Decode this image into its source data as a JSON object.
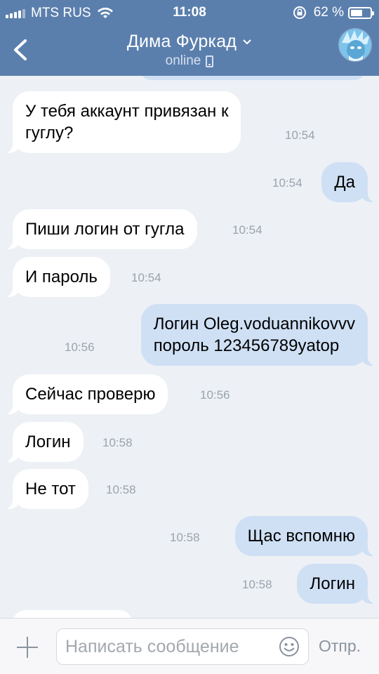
{
  "status_bar": {
    "carrier": "MTS RUS",
    "time": "11:08",
    "battery_percent": "62 %",
    "battery_level": 0.62,
    "icons": [
      "signal-icon",
      "wifi-icon",
      "rotation-lock-icon",
      "battery-icon"
    ]
  },
  "header": {
    "contact_name": "Дима Фуркад",
    "status": "online",
    "icons": [
      "back-arrow-icon",
      "chevron-down-icon",
      "mobile-phone-icon",
      "avatar"
    ],
    "background": "#5b7fad"
  },
  "messages": [
    {
      "dir": "in",
      "lines": [
        "У тебя аккаунт привязан к",
        "гуглу?"
      ],
      "time": "10:54"
    },
    {
      "dir": "out",
      "lines": [
        "Да"
      ],
      "time": "10:54"
    },
    {
      "dir": "in",
      "lines": [
        "Пиши логин от гугла"
      ],
      "time": "10:54"
    },
    {
      "dir": "in",
      "lines": [
        "И пароль"
      ],
      "time": "10:54"
    },
    {
      "dir": "out",
      "lines": [
        "Логин Oleg.voduannikovvv",
        "пороль 123456789yatop"
      ],
      "time": "10:56"
    },
    {
      "dir": "in",
      "lines": [
        "Сейчас проверю"
      ],
      "time": "10:56"
    },
    {
      "dir": "in",
      "lines": [
        "Логин"
      ],
      "time": "10:58"
    },
    {
      "dir": "in",
      "lines": [
        "Не тот"
      ],
      "time": "10:58"
    },
    {
      "dir": "out",
      "lines": [
        "Щас вспомню"
      ],
      "time": "10:58"
    },
    {
      "dir": "out",
      "lines": [
        "Логин"
      ],
      "time": "10:58"
    }
  ],
  "composer": {
    "placeholder": "Написать сообщение",
    "send_label": "Отпр.",
    "icons": [
      "plus-icon",
      "emoji-icon"
    ]
  },
  "colors": {
    "incoming_bubble": "#ffffff",
    "outgoing_bubble": "#cfe0f5",
    "chat_background": "#edf0f5"
  }
}
